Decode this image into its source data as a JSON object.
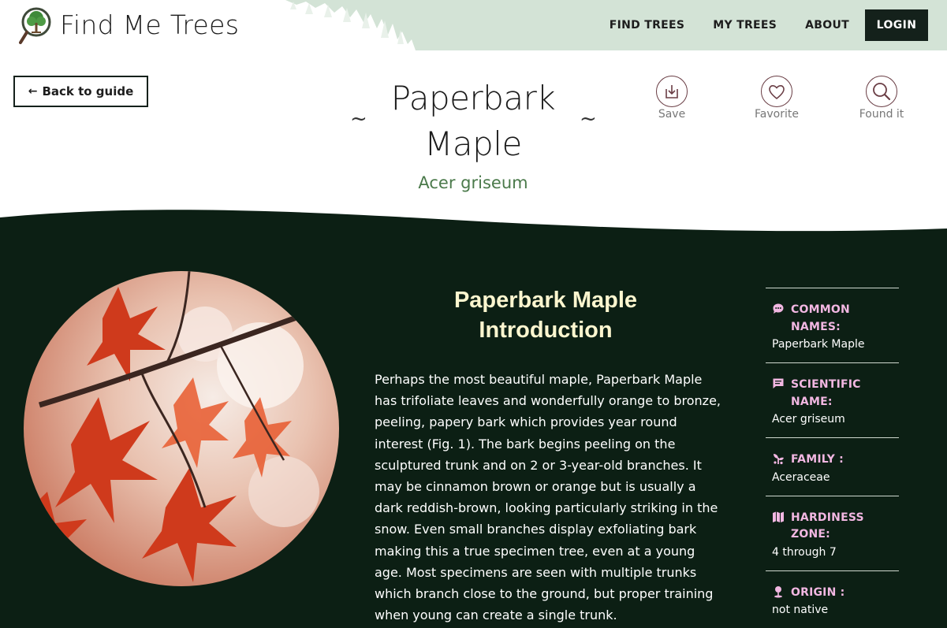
{
  "site": {
    "name": "Find Me Trees"
  },
  "nav": {
    "items": [
      {
        "label": "FIND TREES"
      },
      {
        "label": "MY TREES"
      },
      {
        "label": "ABOUT"
      }
    ],
    "login_label": "LOGIN"
  },
  "back_button": {
    "label": "Back to guide"
  },
  "tree": {
    "title_line1": "Paperbark",
    "title_line2": "Maple",
    "scientific_name": "Acer griseum",
    "tilde": "~"
  },
  "actions": [
    {
      "label": "Save",
      "icon": "save-download-icon"
    },
    {
      "label": "Favorite",
      "icon": "heart-icon"
    },
    {
      "label": "Found it",
      "icon": "magnifier-icon"
    }
  ],
  "intro": {
    "heading_line1": "Paperbark Maple",
    "heading_line2": "Introduction",
    "body": "Perhaps the most beautiful maple, Paperbark Maple has trifoliate leaves and wonderfully orange to bronze, peeling, papery bark which provides year round interest (Fig. 1). The bark begins peeling on the sculptured trunk and on 2 or 3-year-old branches. It may be cinnamon brown or orange but is usually a dark reddish-brown, looking particularly striking in the snow. Even small branches display exfoliating bark making this a true specimen tree, even at a young age. Most specimens are seen with multiple trunks which branch close to the ground, but proper training when young can create a single trunk."
  },
  "facts": [
    {
      "label": "COMMON NAMES:",
      "value": "Paperbark Maple",
      "icon": "speech-bubble-icon"
    },
    {
      "label": "SCIENTIFIC NAME:",
      "value": "Acer griseum",
      "icon": "comment-icon"
    },
    {
      "label": "FAMILY :",
      "value": "Aceraceae",
      "icon": "seedling-icon"
    },
    {
      "label": "HARDINESS ZONE:",
      "value": "4 through 7",
      "icon": "map-icon"
    },
    {
      "label": "ORIGIN :",
      "value": "not native",
      "icon": "map-pin-icon"
    }
  ],
  "colors": {
    "dark_green": "#0c1f14",
    "accent_green": "#4b7a4b",
    "intro_heading": "#fdf6cf",
    "fact_label": "#f2b7e2",
    "login_bg": "#14211b",
    "header_forest": "#d3e3d6"
  }
}
